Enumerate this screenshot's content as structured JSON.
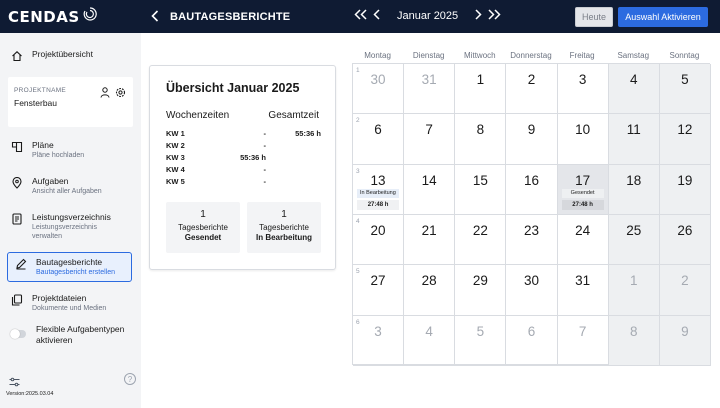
{
  "header": {
    "logo_text": "CENDAS",
    "title": "BAUTAGESBERICHTE",
    "month": "Januar 2025",
    "today_label": "Heute",
    "select_label": "Auswahl Aktivieren",
    "icons": {
      "back": "chevron-left-icon",
      "prev_prev": "double-chevron-left-icon",
      "prev": "chevron-left-icon",
      "next": "chevron-right-icon",
      "next_next": "double-chevron-right-icon"
    },
    "accent_color": "#2c6be0"
  },
  "sidebar": {
    "overview_label": "Projektübersicht",
    "project": {
      "label": "PROJEKTNAME",
      "name": "Fensterbau"
    },
    "items": [
      {
        "title": "Pläne",
        "sub": "Pläne hochladen",
        "icon": "plans-icon"
      },
      {
        "title": "Aufgaben",
        "sub": "Ansicht aller Aufgaben",
        "icon": "location-pin-icon"
      },
      {
        "title": "Leistungsverzeichnis",
        "sub": "Leistungsverzeichnis verwalten",
        "icon": "document-icon"
      },
      {
        "title": "Bautagesberichte",
        "sub": "Bautagesbericht erstellen",
        "icon": "pen-icon",
        "active": true
      },
      {
        "title": "Projektdateien",
        "sub": "Dokumente und Medien",
        "icon": "files-icon"
      }
    ],
    "toggle_label": "Flexible Aufgabentypen aktivieren",
    "toggle_on": false,
    "version": "Version:2025.03.04"
  },
  "summary": {
    "title": "Übersicht Januar 2025",
    "col_week": "Wochenzeiten",
    "col_total": "Gesamtzeit",
    "rows": [
      {
        "kw": "KW 1",
        "week": "-",
        "total": "55:36 h"
      },
      {
        "kw": "KW 2",
        "week": "-",
        "total": ""
      },
      {
        "kw": "KW 3",
        "week": "55:36 h",
        "total": ""
      },
      {
        "kw": "KW 4",
        "week": "-",
        "total": ""
      },
      {
        "kw": "KW 5",
        "week": "-",
        "total": ""
      }
    ],
    "stats": [
      {
        "count": "1",
        "label": "Tagesberichte",
        "status": "Gesendet"
      },
      {
        "count": "1",
        "label": "Tagesberichte",
        "status": "In Bearbeitung"
      }
    ]
  },
  "calendar": {
    "weekdays": [
      "Montag",
      "Dienstag",
      "Mittwoch",
      "Donnerstag",
      "Freitag",
      "Samstag",
      "Sonntag"
    ],
    "weeks": [
      {
        "num": "1",
        "days": [
          {
            "d": "30",
            "muted": true
          },
          {
            "d": "31",
            "muted": true
          },
          {
            "d": "1"
          },
          {
            "d": "2"
          },
          {
            "d": "3"
          },
          {
            "d": "4"
          },
          {
            "d": "5"
          }
        ]
      },
      {
        "num": "2",
        "days": [
          {
            "d": "6"
          },
          {
            "d": "7"
          },
          {
            "d": "8"
          },
          {
            "d": "9"
          },
          {
            "d": "10"
          },
          {
            "d": "11"
          },
          {
            "d": "12"
          }
        ]
      },
      {
        "num": "3",
        "days": [
          {
            "d": "13",
            "status": "In Bearbeitung",
            "time": "27:48 h"
          },
          {
            "d": "14"
          },
          {
            "d": "15"
          },
          {
            "d": "16"
          },
          {
            "d": "17",
            "status": "Gesendet",
            "time": "27:48 h",
            "selected": true
          },
          {
            "d": "18"
          },
          {
            "d": "19"
          }
        ]
      },
      {
        "num": "4",
        "days": [
          {
            "d": "20"
          },
          {
            "d": "21"
          },
          {
            "d": "22"
          },
          {
            "d": "23"
          },
          {
            "d": "24"
          },
          {
            "d": "25"
          },
          {
            "d": "26"
          }
        ]
      },
      {
        "num": "5",
        "days": [
          {
            "d": "27"
          },
          {
            "d": "28"
          },
          {
            "d": "29"
          },
          {
            "d": "30"
          },
          {
            "d": "31"
          },
          {
            "d": "1",
            "muted": true
          },
          {
            "d": "2",
            "muted": true
          }
        ]
      },
      {
        "num": "6",
        "days": [
          {
            "d": "3",
            "muted": true
          },
          {
            "d": "4",
            "muted": true
          },
          {
            "d": "5",
            "muted": true
          },
          {
            "d": "6",
            "muted": true
          },
          {
            "d": "7",
            "muted": true
          },
          {
            "d": "8",
            "muted": true
          },
          {
            "d": "9",
            "muted": true
          }
        ]
      }
    ]
  }
}
